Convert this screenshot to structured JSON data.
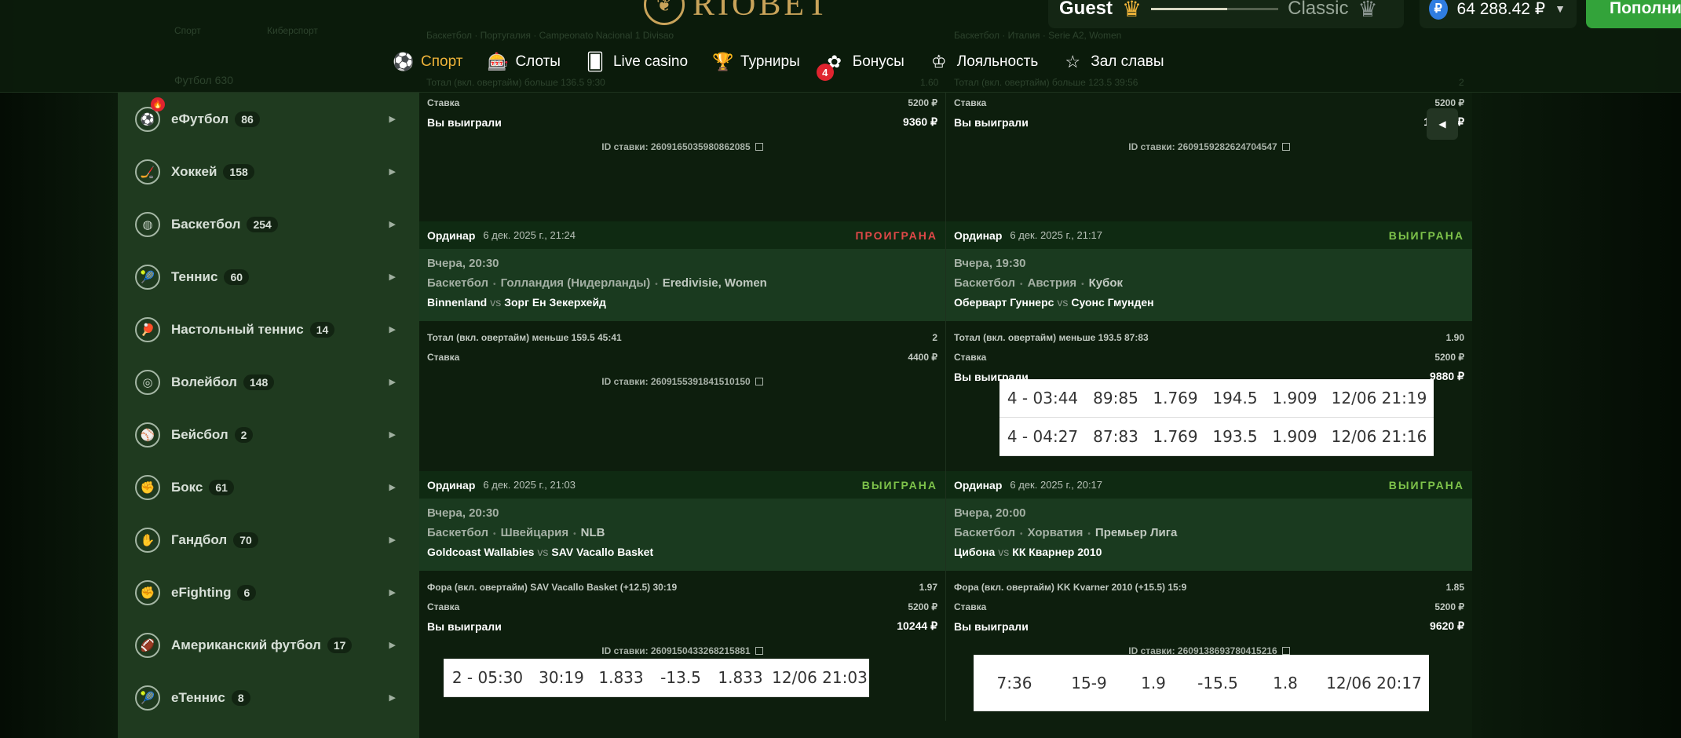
{
  "header": {
    "logo_text": "RIOBET",
    "user": {
      "name": "Guest",
      "level": "Classic",
      "progress_percent": 60
    },
    "balance": "64 288.42 ₽",
    "deposit_label": "Пополнить",
    "ghost_tabs": [
      "Спорт",
      "Киберспорт"
    ],
    "ghost_leagues": [
      "Баскетбол · Португалия · Campeonato Nacional 1 Divisao",
      "Баскетбол · Италия · Serie A2, Women"
    ],
    "ghost_bet_rows": [
      "Тотал (вкл. овертайм) больше 136.5   9:30",
      "1.60",
      "Тотал (вкл. овертайм) больше 123.5   39:56",
      "2"
    ],
    "ghost_sport": {
      "name": "Футбол",
      "count": "630"
    }
  },
  "nav": [
    {
      "label": "Спорт",
      "icon": "soccer-ball-icon",
      "active": true
    },
    {
      "label": "Слоты",
      "icon": "slot-machine-icon"
    },
    {
      "label": "Live casino",
      "icon": "cards-icon"
    },
    {
      "label": "Турниры",
      "icon": "trophy-icon"
    },
    {
      "label": "Бонусы",
      "icon": "gift-icon",
      "badge": "4"
    },
    {
      "label": "Лояльность",
      "icon": "crown-icon"
    },
    {
      "label": "Зал славы",
      "icon": "star-icon"
    }
  ],
  "sidebar": [
    {
      "name": "еФутбол",
      "count": "86",
      "icon": "esoccer-icon",
      "hot": true
    },
    {
      "name": "Хоккей",
      "count": "158",
      "icon": "hockey-icon"
    },
    {
      "name": "Баскетбол",
      "count": "254",
      "icon": "basketball-icon"
    },
    {
      "name": "Теннис",
      "count": "60",
      "icon": "tennis-icon"
    },
    {
      "name": "Настольный теннис",
      "count": "14",
      "icon": "table-tennis-icon"
    },
    {
      "name": "Волейбол",
      "count": "148",
      "icon": "volleyball-icon"
    },
    {
      "name": "Бейсбол",
      "count": "2",
      "icon": "baseball-icon"
    },
    {
      "name": "Бокс",
      "count": "61",
      "icon": "boxing-icon"
    },
    {
      "name": "Гандбол",
      "count": "70",
      "icon": "handball-icon"
    },
    {
      "name": "eFighting",
      "count": "6",
      "icon": "efighting-icon"
    },
    {
      "name": "Американский футбол",
      "count": "17",
      "icon": "american-football-icon"
    },
    {
      "name": "еТеннис",
      "count": "8",
      "icon": "etennis-icon"
    }
  ],
  "labels": {
    "stake": "Ставка",
    "won": "Вы выиграли",
    "bet_id": "ID ставки:",
    "vs": "vs"
  },
  "top_cards": [
    {
      "stake": "5200 ₽",
      "win": "9360 ₽",
      "id": "2609165035980862085"
    },
    {
      "stake": "5200 ₽",
      "win": "10400 ₽",
      "id": "2609159282624704547"
    }
  ],
  "cards": [
    {
      "type": "Ординар",
      "date": "6 дек. 2025 г., 21:24",
      "status": "ПРОИГРАНА",
      "result": "lose",
      "time": "Вчера, 20:30",
      "sport": "Баскетбол",
      "country": "Голландия (Нидерланды)",
      "league": "Eredivisie, Women",
      "home": "Binnenland",
      "away": "Зорг Ен Зекерхейд",
      "market": "Тотал (вкл. овертайм) меньше 159.5   45:41",
      "odds": "2",
      "stake": "4400 ₽",
      "win": "",
      "id": "2609155391841510150"
    },
    {
      "type": "Ординар",
      "date": "6 дек. 2025 г., 21:17",
      "status": "ВЫИГРАНА",
      "result": "win",
      "time": "Вчера, 19:30",
      "sport": "Баскетбол",
      "country": "Австрия",
      "league": "Кубок",
      "home": "Оберварт Гуннерс",
      "away": "Суонс Гмунден",
      "market": "Тотал (вкл. овертайм) меньше 193.5   87:83",
      "odds": "1.90",
      "stake": "5200 ₽",
      "win": "9880 ₽",
      "id": ""
    },
    {
      "type": "Ординар",
      "date": "6 дек. 2025 г., 21:03",
      "status": "ВЫИГРАНА",
      "result": "win",
      "time": "Вчера, 20:30",
      "sport": "Баскетбол",
      "country": "Швейцария",
      "league": "NLB",
      "home": "Goldcoast Wallabies",
      "away": "SAV Vacallo Basket",
      "market": "Фора (вкл. овертайм) SAV Vacallo Basket (+12.5)   30:19",
      "odds": "1.97",
      "stake": "5200 ₽",
      "win": "10244 ₽",
      "id": "2609150433268215881"
    },
    {
      "type": "Ординар",
      "date": "6 дек. 2025 г., 20:17",
      "status": "ВЫИГРАНА",
      "result": "win",
      "time": "Вчера, 20:00",
      "sport": "Баскетбол",
      "country": "Хорватия",
      "league": "Премьер Лига",
      "home": "Цибона",
      "away": "КК Кварнер 2010",
      "market": "Фора (вкл. овертайм) KK Kvarner 2010 (+15.5)   15:9",
      "odds": "1.85",
      "stake": "5200 ₽",
      "win": "9620 ₽",
      "id": "2609138693780415216"
    }
  ],
  "overlays": [
    {
      "rows": [
        [
          "4 - 03:44",
          "89:85",
          "1.769",
          "194.5",
          "1.909",
          "12/06 21:19"
        ],
        [
          "4 - 04:27",
          "87:83",
          "1.769",
          "193.5",
          "1.909",
          "12/06 21:16"
        ]
      ]
    },
    {
      "rows": [
        [
          "2 - 05:30",
          "30:19",
          "1.833",
          "-13.5",
          "1.833",
          "12/06 21:03"
        ]
      ]
    },
    {
      "rows": [
        [
          "7:36",
          "15-9",
          "1.9",
          "-15.5",
          "1.8",
          "12/06 20:17"
        ]
      ]
    }
  ]
}
